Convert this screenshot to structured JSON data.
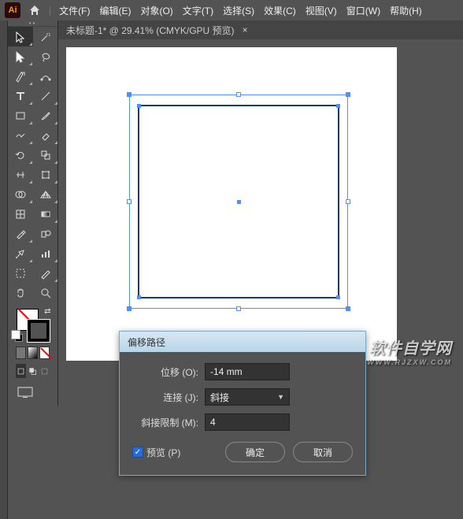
{
  "app": {
    "short": "Ai"
  },
  "menus": [
    "文件(F)",
    "编辑(E)",
    "对象(O)",
    "文字(T)",
    "选择(S)",
    "效果(C)",
    "视图(V)",
    "窗口(W)",
    "帮助(H)"
  ],
  "doc_tab": {
    "title": "未标题-1* @ 29.41%  (CMYK/GPU 预览)",
    "close": "×"
  },
  "dialog": {
    "title": "偏移路径",
    "offset_label": "位移 (O):",
    "offset_value": "-14 mm",
    "join_label": "连接 (J):",
    "join_value": "斜接",
    "miter_label": "斜接限制 (M):",
    "miter_value": "4",
    "preview_label": "预览 (P)",
    "ok": "确定",
    "cancel": "取消"
  },
  "watermark": {
    "big": "软件自学网",
    "small": "WWW.RJZXW.COM"
  },
  "tool_names": [
    "selection-tool",
    "magic-wand-tool",
    "direct-selection-tool",
    "lasso-tool",
    "pen-tool",
    "curvature-tool",
    "type-tool",
    "line-tool",
    "rectangle-tool",
    "paintbrush-tool",
    "shaper-tool",
    "eraser-tool",
    "rotate-tool",
    "scale-tool",
    "width-tool",
    "free-transform-tool",
    "shape-builder-tool",
    "perspective-grid-tool",
    "mesh-tool",
    "gradient-tool",
    "eyedropper-tool",
    "blend-tool",
    "symbol-sprayer-tool",
    "column-graph-tool",
    "artboard-tool",
    "slice-tool",
    "hand-tool",
    "zoom-tool"
  ]
}
